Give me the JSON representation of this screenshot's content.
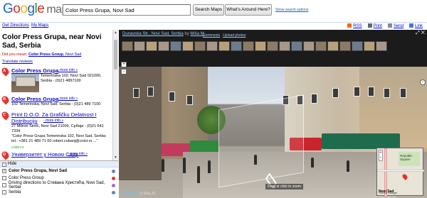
{
  "header": {
    "logo_parts": [
      "G",
      "o",
      "o",
      "g",
      "l",
      "e"
    ],
    "logo_suffix": "maps",
    "search_value": "Color Press Grupa, Novi Sad",
    "search_button": "Search Maps",
    "around_button": "What's Around Here?",
    "options_link": "Show search options"
  },
  "subbar": {
    "get_directions": "Get Directions",
    "my_maps": "My Maps",
    "rss": "RSS",
    "print": "Print",
    "send": "Send",
    "link": "Link"
  },
  "results": {
    "heading": "Color Press Grupa, near Novi Sad, Serbia",
    "did_you_mean_prefix": "Did you mean: ",
    "did_you_mean_bold": "Color Press Group",
    "did_you_mean_rest": ", Novi Sad",
    "translate": "Translate reviews",
    "items": [
      {
        "marker": "A",
        "title": "Color Press Grupa",
        "more": "- more info »",
        "address": "Temerinska 102, Novi Sad 021000, Serbia - (0)21 4897100"
      },
      {
        "marker": "B",
        "title": "Color Press Grupa",
        "more": "- more info »",
        "address": "102 Temerinska, Novi Sad, Serbia - (0)21 489 7100"
      },
      {
        "marker": "C",
        "title_line1": "Print D.O.O. Za Grafičku Delatnost I",
        "title_line2": "Distribuciju",
        "more": "- more info »",
        "address": "27 Mileve Simić, Novi Sad 21000, Србија - (0)21 641 7334",
        "quote": "\"Color Press Grupa Temerinska 102, Novi Sad, Serbia: tel.: +381 21 489 71 00 robert.cobanj@color.rs ...\"",
        "site": "color.rs"
      },
      {
        "marker": "D",
        "title": "Универзитет у Новом Саду",
        "more": "- more info »"
      }
    ]
  },
  "layers": {
    "hide": "Hide",
    "rows": [
      {
        "label": "Color Press Grupa, Novi Sad",
        "checked": true,
        "bold": true,
        "color": "#5b84c4"
      },
      {
        "label": "Color Press Group",
        "checked": false,
        "bold": false,
        "color": "#e3342f"
      },
      {
        "label": "Driving directions to Стевана Христића, Novi Sad, Serbia",
        "checked": false,
        "bold": false,
        "color": "#9a6fcf"
      },
      {
        "label": "Serbia",
        "checked": false,
        "bold": false,
        "color": "#5b84c4"
      }
    ]
  },
  "streetview": {
    "street_link": "Dunavska Str., Novi Sad, Serbia",
    "by": "by",
    "author": "Miša M.",
    "comments": "Comments",
    "upload": "Upload photos",
    "drag_hint": "Drag or click to zoom",
    "powered_by": "Panoramio",
    "copyright": "© Miša M.",
    "minimap_city": "Novi Sad",
    "minimap_square": "Republic Square",
    "minimap_copyright": "©2010 Google"
  },
  "colors": {
    "accent_link": "#0000cc",
    "pin_red": "#e3342f",
    "layer_bar": "#e5ecf9"
  }
}
